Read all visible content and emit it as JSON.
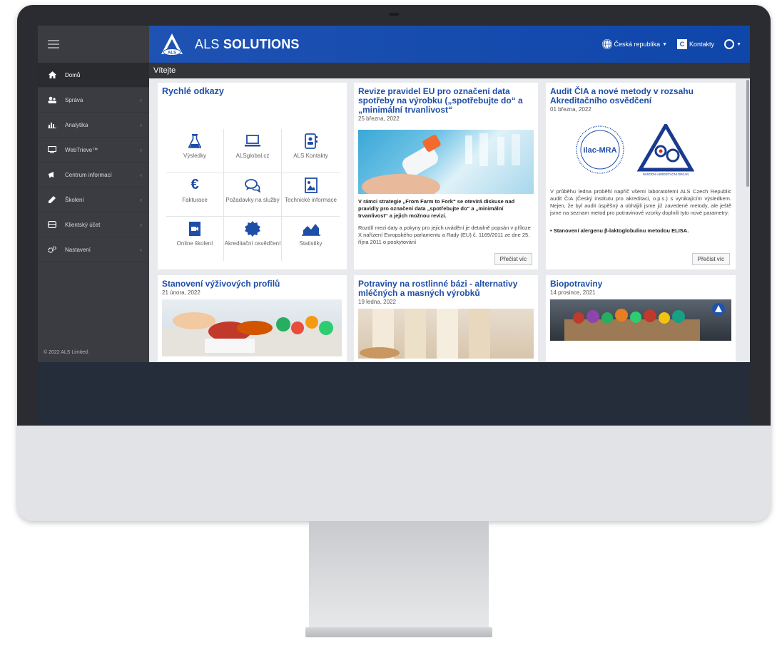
{
  "topbar": {
    "brand_prefix": "ALS",
    "brand_main": "SOLUTIONS",
    "country": "Česká republika",
    "contacts": "Kontakty"
  },
  "subheader": {
    "title": "Vítejte"
  },
  "sidebar": {
    "items": [
      {
        "label": "Domů",
        "icon": "home-icon"
      },
      {
        "label": "Správa",
        "icon": "users-icon"
      },
      {
        "label": "Analytika",
        "icon": "bar-chart-icon"
      },
      {
        "label": "WebTrieve™",
        "icon": "monitor-icon"
      },
      {
        "label": "Centrum informací",
        "icon": "megaphone-icon"
      },
      {
        "label": "Školení",
        "icon": "pen-icon"
      },
      {
        "label": "Klientský účet",
        "icon": "box-icon"
      },
      {
        "label": "Nastavení",
        "icon": "gears-icon"
      }
    ],
    "copyright": "© 2022 ALS Limited."
  },
  "quick_links": {
    "title": "Rychlé odkazy",
    "items": [
      {
        "label": "Výsledky",
        "icon": "flask-icon"
      },
      {
        "label": "ALSglobal.cz",
        "icon": "laptop-icon"
      },
      {
        "label": "ALS Kontakty",
        "icon": "contact-book-icon"
      },
      {
        "label": "Fakturace",
        "icon": "euro-icon"
      },
      {
        "label": "Požadavky na služby",
        "icon": "chat-icon"
      },
      {
        "label": "Technické informace",
        "icon": "image-file-icon"
      },
      {
        "label": "Online školení",
        "icon": "video-file-icon"
      },
      {
        "label": "Akreditační osvědčení",
        "icon": "certificate-seal-icon"
      },
      {
        "label": "Statistiky",
        "icon": "area-chart-icon"
      }
    ]
  },
  "news": [
    {
      "title": "Revize pravidel EU pro označení data spotřeby na výrobku („spotřebujte do“ a „minimální trvanlivost“",
      "date": "25 března, 2022",
      "lead": "V rámci strategie „From Farm to Fork“ se otevírá diskuse nad pravidly pro označení data „spotřebujte do“ a „minimální trvanlivost“ a jejich možnou revizí.",
      "body": "Rozdíl mezi daty a pokyny pro jejich uvádění je detailně popsán v příloze X nařízení Evropského parlamentu a Rady (EU) č. 1169/2011 ze dne 25. října 2011 o poskytování",
      "button": "Přečíst víc"
    },
    {
      "title": "Audit ČIA a nové metody v rozsahu Akreditačního osvědčení",
      "date": "01 března, 2022",
      "logo_text": "ilac-MRA",
      "logo2_caption": "NÁRODNÍ AKREDITAČNÍ ORGÁN",
      "body": "V průběhu ledna proběhl napříč všemi laboratořemi ALS Czech Republic audit ČIA (Český institutu pro akreditaci, o.p.s.) s vynikajícím výsledkem. Nejen, že byl audit úspěšný a obhájili jsme již zavedené metody, ale ještě jsme na seznam metod pro potravinové vzorky doplnili tyto nové parametry:",
      "bullet": "Stanovení alergenu β-laktoglobulinu metodou ELISA.",
      "button": "Přečíst víc"
    },
    {
      "title": "Stanovení výživových profilů",
      "date": "21 února, 2022"
    },
    {
      "title": "Potraviny na rostlinné bázi - alternativy mléčných a masných výrobků",
      "date": "19 ledna, 2022"
    },
    {
      "title": "Biopotraviny",
      "date": "14 prosince, 2021"
    }
  ],
  "colors": {
    "brand_blue": "#1e52b3",
    "sidebar": "#3a3c41",
    "link_title": "#1f4ea7"
  }
}
